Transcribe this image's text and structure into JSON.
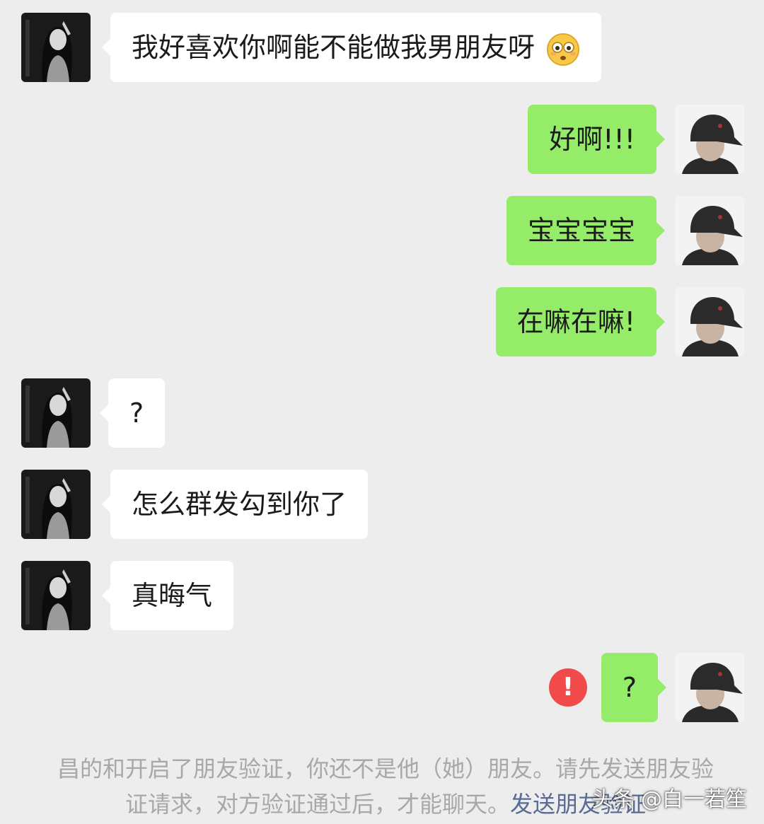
{
  "messages": [
    {
      "side": "in",
      "text": "我好喜欢你啊能不能做我男朋友呀",
      "emoji": "flushed-face"
    },
    {
      "side": "out",
      "text": "好啊!!!"
    },
    {
      "side": "out",
      "text": "宝宝宝宝"
    },
    {
      "side": "out",
      "text": "在嘛在嘛!"
    },
    {
      "side": "in",
      "text": "?"
    },
    {
      "side": "in",
      "text": "怎么群发勾到你了"
    },
    {
      "side": "in",
      "text": "真晦气"
    },
    {
      "side": "out",
      "text": "?",
      "status": "send-failed"
    }
  ],
  "status_icon_glyph": "!",
  "system_notice": {
    "text": "昌的和开启了朋友验证，你还不是他（她）朋友。请先发送朋友验证请求，对方验证通过后，才能聊天。",
    "link": "发送朋友验证"
  },
  "watermark": "头条 @白一若笙",
  "colors": {
    "background": "#ededed",
    "incoming_bubble": "#ffffff",
    "outgoing_bubble": "#95ec69",
    "error": "#f04a4a",
    "link": "#576b95"
  }
}
